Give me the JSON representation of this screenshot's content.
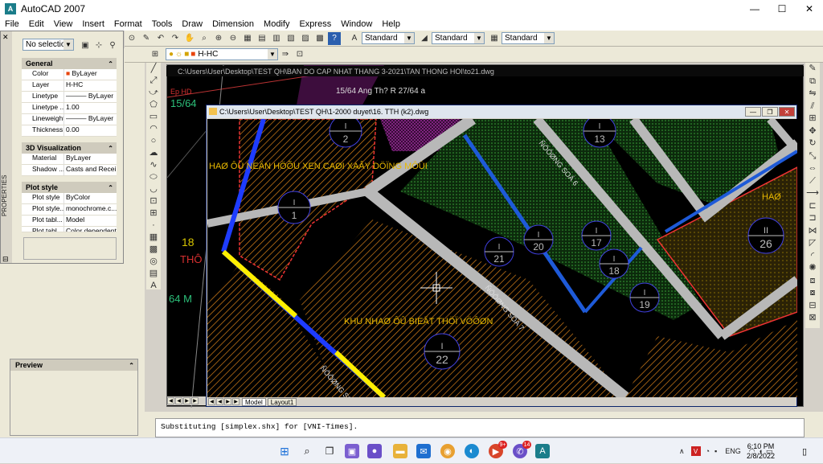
{
  "window": {
    "title": "AutoCAD 2007",
    "minimize": "—",
    "maximize": "☐",
    "close": "✕"
  },
  "menu": [
    "File",
    "Edit",
    "View",
    "Insert",
    "Format",
    "Tools",
    "Draw",
    "Dimension",
    "Modify",
    "Express",
    "Window",
    "Help"
  ],
  "styles_toolbar": {
    "text_style": "Standard",
    "dim_style": "Standard",
    "table_style": "Standard"
  },
  "layers_toolbar": {
    "current_layer": "H-HC"
  },
  "properties": {
    "side_label": "PROPERTIES",
    "selection": "No selection",
    "general": {
      "header": "General",
      "rows": [
        {
          "key": "Color",
          "value": "ByLayer",
          "swatch": "#e8440c"
        },
        {
          "key": "Layer",
          "value": "H-HC"
        },
        {
          "key": "Linetype",
          "value": "ByLayer"
        },
        {
          "key": "Linetype ...",
          "value": "1.00"
        },
        {
          "key": "Lineweight",
          "value": "ByLayer"
        },
        {
          "key": "Thickness",
          "value": "0.00"
        }
      ]
    },
    "visualization": {
      "header": "3D Visualization",
      "rows": [
        {
          "key": "Material",
          "value": "ByLayer"
        },
        {
          "key": "Shadow ...",
          "value": "Casts and Recei..."
        }
      ]
    },
    "plot_style": {
      "header": "Plot style",
      "rows": [
        {
          "key": "Plot style",
          "value": "ByColor"
        },
        {
          "key": "Plot style...",
          "value": "monochrome.c..."
        },
        {
          "key": "Plot tabl...",
          "value": "Model"
        },
        {
          "key": "Plot tabl...",
          "value": "Color dependent"
        }
      ]
    }
  },
  "preview": {
    "header": "Preview"
  },
  "background_drawing": {
    "path": "C:\\Users\\User\\Desktop\\TEST QH\\BAN DO CAP NHAT THANG 3-2021\\TAN THONG HOI\\to21.dwg",
    "annotation": "15/64 Ang Th? R 27/64 a",
    "labels": [
      "Ep HD",
      "15/64",
      "18",
      "THÔ",
      "64 M",
      "2"
    ]
  },
  "inner_window": {
    "path": "C:\\Users\\User\\Desktop\\TEST QH\\1-2000 duyet\\16. TTH (k2).dwg",
    "tabs": [
      "Model",
      "Layout1"
    ],
    "text_labels": [
      "KHU NHAØ ÔÛ BIEÄT THÖÏ VÖÔØN",
      "HAØ ÔÛ NEÄN HÖÕU XEN CAØI XAÂY DÖÏNG MÔÙI",
      "ÑÖÔØNG SOÁ 6",
      "ÑÖÔØNG SOÁ 7",
      "ÑÖÔØNG SOÁ",
      "HAØ"
    ],
    "lot_markers": [
      {
        "top": "I",
        "num": "1"
      },
      {
        "top": "I",
        "num": "2"
      },
      {
        "top": "I",
        "num": "13"
      },
      {
        "top": "I",
        "num": "20"
      },
      {
        "top": "I",
        "num": "21"
      },
      {
        "top": "I",
        "num": "17"
      },
      {
        "top": "I",
        "num": "18"
      },
      {
        "top": "I",
        "num": "19"
      },
      {
        "top": "I",
        "num": "22"
      },
      {
        "top": "II",
        "num": "26"
      }
    ]
  },
  "command_line": "Substituting [simplex.shx] for [VNI-Times].",
  "taskbar": {
    "badges": {
      "mail": "9+",
      "video": "14"
    },
    "language": "ENG",
    "time": "6:10 PM",
    "date": "2/8/2022",
    "caret": "∧"
  }
}
